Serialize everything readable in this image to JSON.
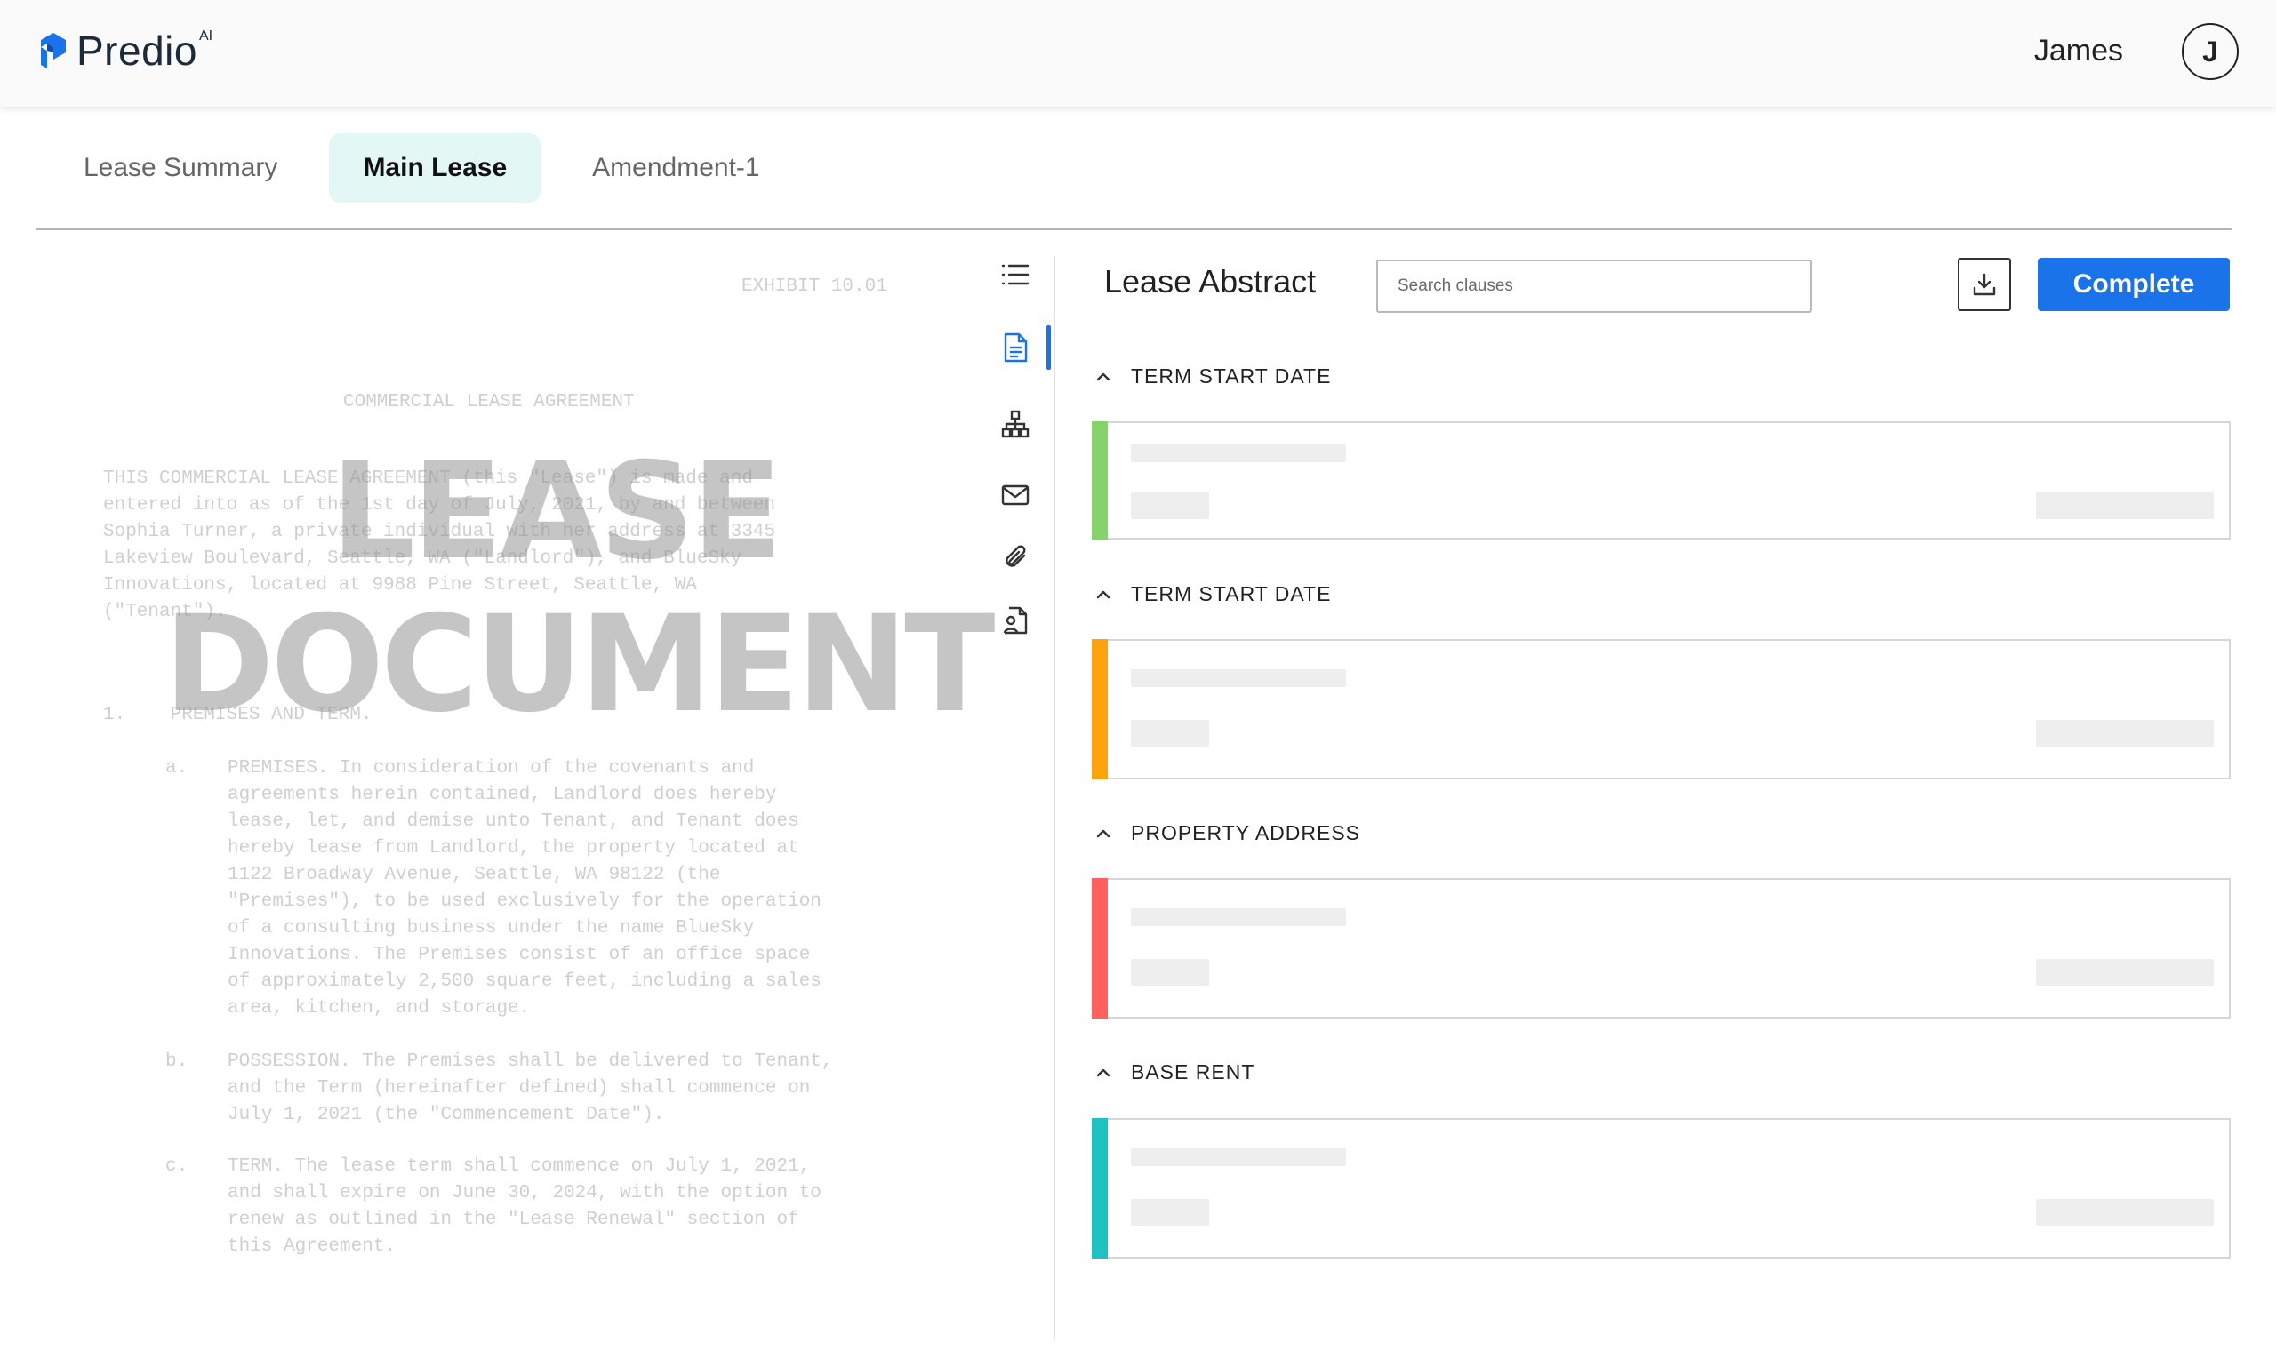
{
  "header": {
    "logo_text": "Predio",
    "logo_superscript": "AI",
    "user_name": "James",
    "avatar_initial": "J"
  },
  "tabs": [
    {
      "label": "Lease Summary",
      "active": false
    },
    {
      "label": "Main Lease",
      "active": true
    },
    {
      "label": "Amendment-1",
      "active": false
    }
  ],
  "document": {
    "exhibit": "EXHIBIT 10.01",
    "title": "COMMERCIAL LEASE AGREEMENT",
    "intro": "THIS COMMERCIAL LEASE AGREEMENT (this \"Lease\") is made and\nentered into as of the 1st day of July, 2021, by and between\nSophia Turner, a private individual with her address at 3345\nLakeview Boulevard, Seattle, WA (\"Landlord\"), and BlueSky\nInnovations, located at 9988 Pine Street, Seattle, WA\n(\"Tenant\").",
    "section1": "1.    PREMISES AND TERM.",
    "items": [
      {
        "label": "a.",
        "text": "PREMISES. In consideration of the covenants and\nagreements herein contained, Landlord does hereby\nlease, let, and demise unto Tenant, and Tenant does\nhereby lease from Landlord, the property located at\n1122 Broadway Avenue, Seattle, WA 98122 (the\n\"Premises\"), to be used exclusively for the operation\nof a consulting business under the name BlueSky\nInnovations. The Premises consist of an office space\nof approximately 2,500 square feet, including a sales\narea, kitchen, and storage."
      },
      {
        "label": "b.",
        "text": "POSSESSION. The Premises shall be delivered to Tenant,\nand the Term (hereinafter defined) shall commence on\nJuly 1, 2021 (the \"Commencement Date\")."
      },
      {
        "label": "c.",
        "text": "TERM. The lease term shall commence on July 1, 2021,\nand shall expire on June 30, 2024, with the option to\nrenew as outlined in the \"Lease Renewal\" section of\nthis Agreement."
      }
    ],
    "watermark_line1": "LEASE",
    "watermark_line2": "DOCUMENT"
  },
  "rail": {
    "icons": [
      "list-icon",
      "document-icon",
      "hierarchy-icon",
      "mail-icon",
      "paperclip-icon",
      "contact-file-icon"
    ],
    "active_index": 1,
    "active_color": "#1a73e8"
  },
  "abstract": {
    "title": "Lease Abstract",
    "search_placeholder": "Search clauses",
    "complete_label": "Complete",
    "sections": [
      {
        "label": "TERM START DATE",
        "accent": "#86d36b"
      },
      {
        "label": "TERM START DATE",
        "accent": "#ffa20f"
      },
      {
        "label": "PROPERTY ADDRESS",
        "accent": "#ff6161"
      },
      {
        "label": "BASE RENT",
        "accent": "#1ec2c2"
      }
    ]
  },
  "colors": {
    "primary": "#1a73e8",
    "tab_active_bg": "#e3f7f5"
  }
}
